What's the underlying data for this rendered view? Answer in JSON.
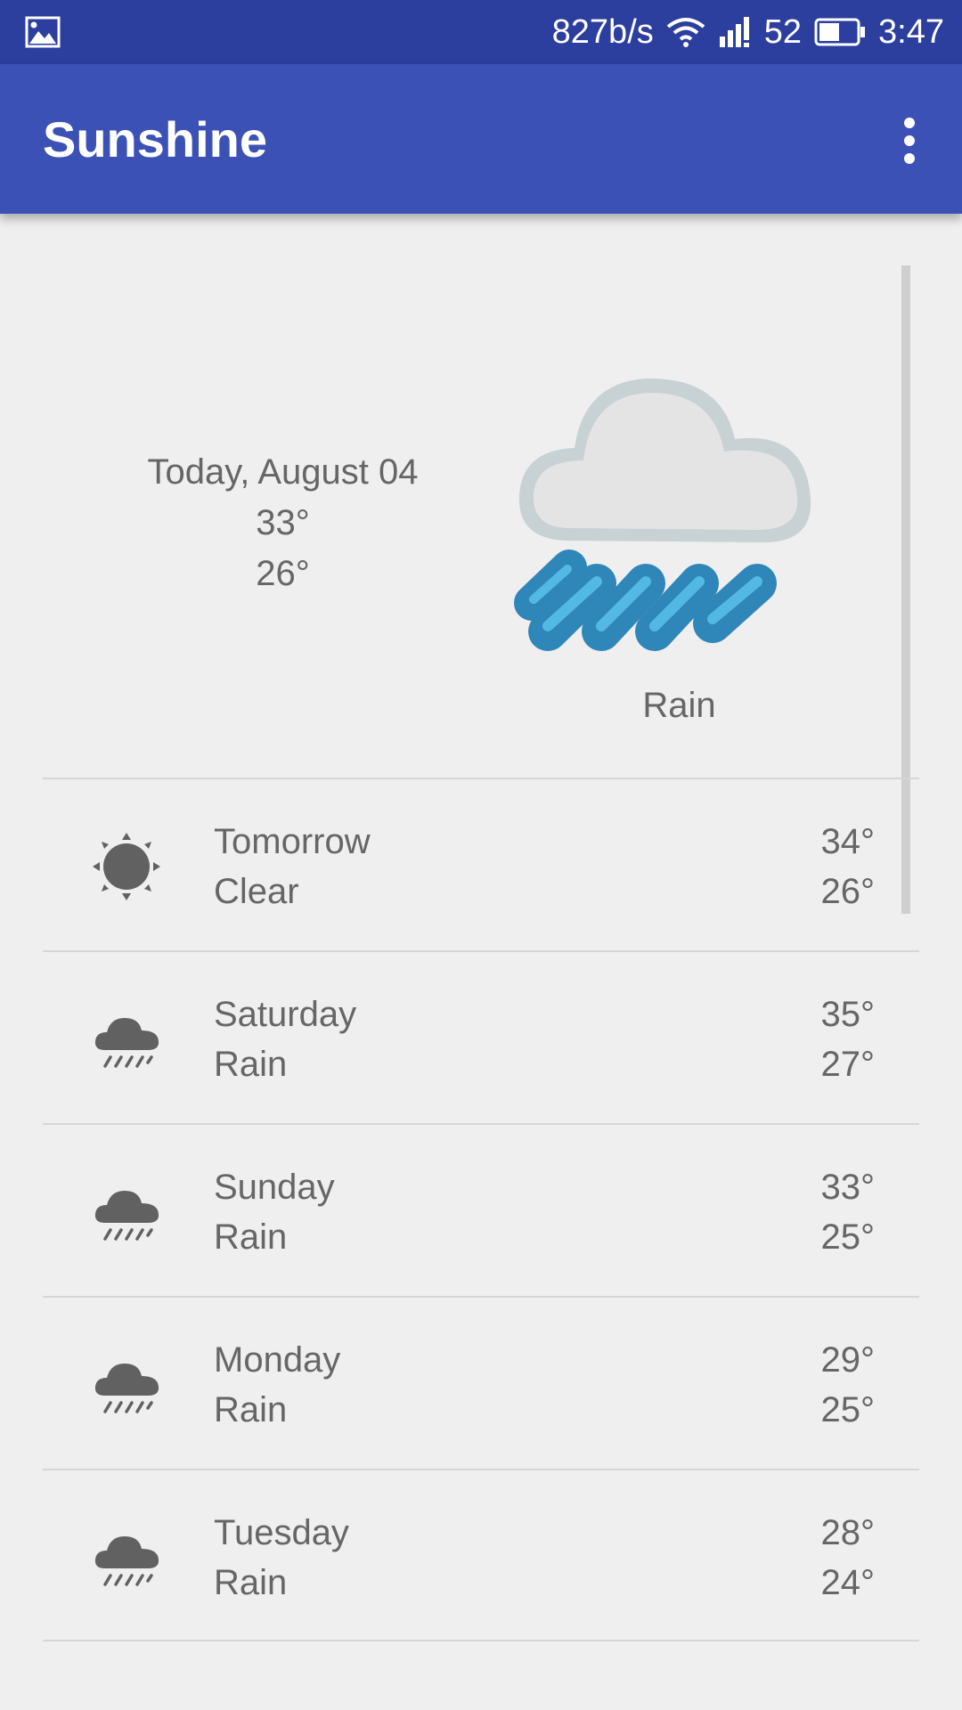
{
  "status_bar": {
    "network_speed": "827b/s",
    "signal_label": "52",
    "time": "3:47",
    "icons": [
      "image-icon",
      "wifi-icon",
      "signal-icon",
      "battery-icon"
    ]
  },
  "app_bar": {
    "title": "Sunshine",
    "menu_icon": "overflow-menu-icon",
    "background": "#3c51b6"
  },
  "today": {
    "date": "Today, August 04",
    "high": "33°",
    "low": "26°",
    "condition": "Rain",
    "icon": "rain-art-icon"
  },
  "forecast": [
    {
      "day": "Tomorrow",
      "condition": "Clear",
      "high": "34°",
      "low": "26°",
      "icon": "sun-icon"
    },
    {
      "day": "Saturday",
      "condition": "Rain",
      "high": "35°",
      "low": "27°",
      "icon": "rain-icon"
    },
    {
      "day": "Sunday",
      "condition": "Rain",
      "high": "33°",
      "low": "25°",
      "icon": "rain-icon"
    },
    {
      "day": "Monday",
      "condition": "Rain",
      "high": "29°",
      "low": "25°",
      "icon": "rain-icon"
    },
    {
      "day": "Tuesday",
      "condition": "Rain",
      "high": "28°",
      "low": "24°",
      "icon": "rain-icon"
    }
  ]
}
